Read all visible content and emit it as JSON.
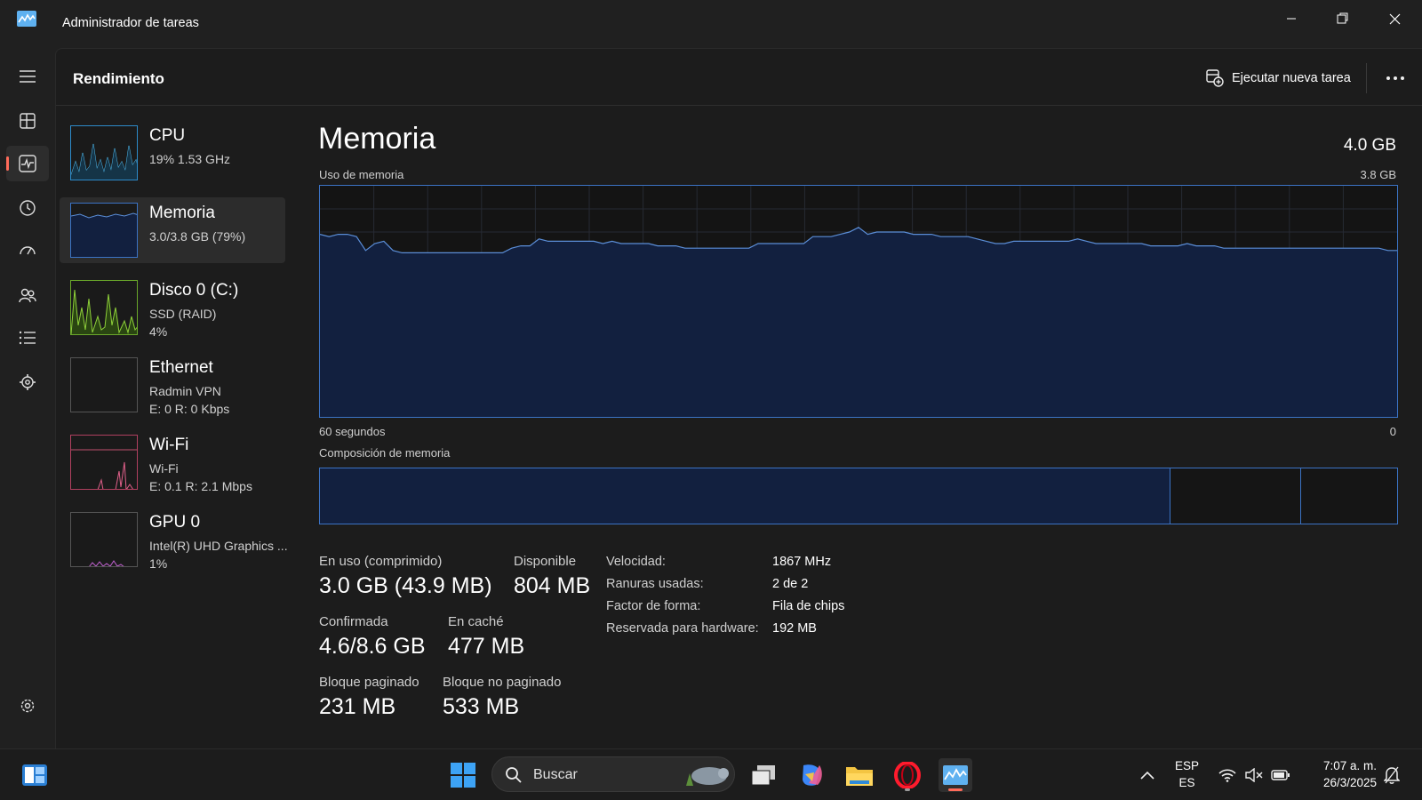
{
  "window": {
    "title": "Administrador de tareas"
  },
  "header": {
    "title": "Rendimiento",
    "run_task_label": "Ejecutar nueva tarea"
  },
  "sidebar": {
    "items": [
      {
        "name": "CPU",
        "line1": "19%  1.53 GHz",
        "line2": ""
      },
      {
        "name": "Memoria",
        "line1": "3.0/3.8 GB (79%)",
        "line2": ""
      },
      {
        "name": "Disco 0 (C:)",
        "line1": "SSD (RAID)",
        "line2": "4%"
      },
      {
        "name": "Ethernet",
        "line1": "Radmin VPN",
        "line2": "E: 0  R: 0 Kbps"
      },
      {
        "name": "Wi-Fi",
        "line1": "Wi-Fi",
        "line2": "E: 0.1  R: 2.1 Mbps"
      },
      {
        "name": "GPU 0",
        "line1": "Intel(R) UHD Graphics ...",
        "line2": "1%"
      }
    ]
  },
  "memory": {
    "title": "Memoria",
    "total": "4.0 GB",
    "usage_label": "Uso de memoria",
    "usage_max": "3.8 GB",
    "time_label": "60 segundos",
    "time_zero": "0",
    "composition_label": "Composición de memoria",
    "composition": {
      "in_use_fraction": 0.79,
      "modified_fraction": 0.12
    },
    "usage_history_fraction": [
      0.79,
      0.78,
      0.79,
      0.79,
      0.78,
      0.72,
      0.75,
      0.76,
      0.72,
      0.71,
      0.71,
      0.71,
      0.71,
      0.71,
      0.71,
      0.71,
      0.71,
      0.71,
      0.71,
      0.71,
      0.71,
      0.73,
      0.74,
      0.74,
      0.77,
      0.76,
      0.76,
      0.76,
      0.76,
      0.76,
      0.76,
      0.75,
      0.76,
      0.75,
      0.75,
      0.75,
      0.75,
      0.74,
      0.74,
      0.74,
      0.73,
      0.73,
      0.73,
      0.73,
      0.73,
      0.73,
      0.73,
      0.73,
      0.75,
      0.75,
      0.75,
      0.75,
      0.75,
      0.75,
      0.78,
      0.78,
      0.78,
      0.79,
      0.8,
      0.82,
      0.79,
      0.8,
      0.8,
      0.8,
      0.8,
      0.79,
      0.79,
      0.79,
      0.78,
      0.78,
      0.78,
      0.78,
      0.77,
      0.76,
      0.75,
      0.75,
      0.76,
      0.76,
      0.76,
      0.76,
      0.76,
      0.76,
      0.76,
      0.77,
      0.76,
      0.75,
      0.75,
      0.75,
      0.75,
      0.75,
      0.75,
      0.74,
      0.74,
      0.74,
      0.74,
      0.75,
      0.74,
      0.74,
      0.74,
      0.73,
      0.73,
      0.73,
      0.73,
      0.73,
      0.73,
      0.73,
      0.73,
      0.73,
      0.73,
      0.73,
      0.73,
      0.73,
      0.73,
      0.73,
      0.73,
      0.73,
      0.73,
      0.72,
      0.72
    ],
    "stats": {
      "in_use_label": "En uso (comprimido)",
      "in_use_value": "3.0 GB (43.9 MB)",
      "available_label": "Disponible",
      "available_value": "804 MB",
      "committed_label": "Confirmada",
      "committed_value": "4.6/8.6 GB",
      "cached_label": "En caché",
      "cached_value": "477 MB",
      "paged_label": "Bloque paginado",
      "paged_value": "231 MB",
      "nonpaged_label": "Bloque no paginado",
      "nonpaged_value": "533 MB"
    },
    "props": [
      {
        "label": "Velocidad:",
        "value": "1867 MHz"
      },
      {
        "label": "Ranuras usadas:",
        "value": "2 de 2"
      },
      {
        "label": "Factor de forma:",
        "value": "Fila de chips"
      },
      {
        "label": "Reservada para hardware:",
        "value": "192 MB"
      }
    ]
  },
  "taskbar": {
    "search_placeholder": "Buscar",
    "lang_1": "ESP",
    "lang_2": "ES",
    "time": "7:07 a. m.",
    "date": "26/3/2025"
  },
  "colors": {
    "accent": "#3b73c4",
    "fill": "#12203f",
    "indicator": "#ff6b5a"
  }
}
